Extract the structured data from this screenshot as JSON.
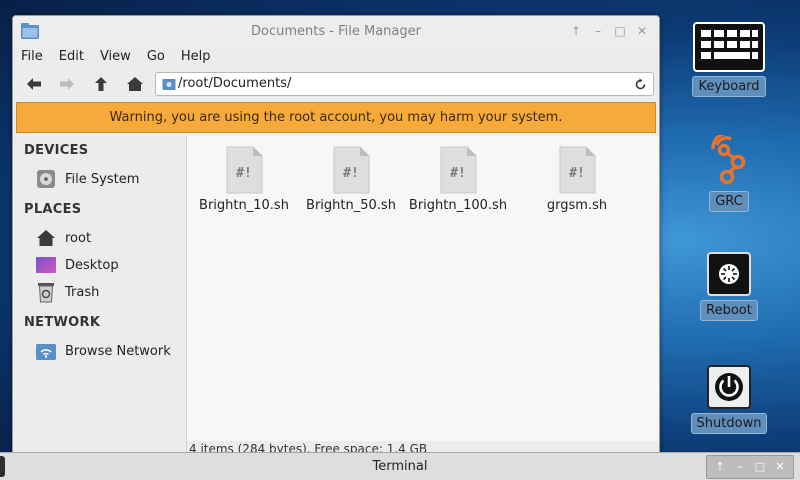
{
  "window": {
    "title": "Documents - File Manager",
    "buttons": [
      "↑",
      "–",
      "□",
      "✕"
    ]
  },
  "menu": [
    "File",
    "Edit",
    "View",
    "Go",
    "Help"
  ],
  "location": {
    "path": "/root/Documents/"
  },
  "warning": "Warning, you are using the root account, you may harm your system.",
  "sidebar": {
    "devices_heading": "DEVICES",
    "places_heading": "PLACES",
    "network_heading": "NETWORK",
    "devices": [
      {
        "label": "File System",
        "icon": "drive-icon"
      }
    ],
    "places": [
      {
        "label": "root",
        "icon": "home-icon"
      },
      {
        "label": "Desktop",
        "icon": "desktop-icon"
      },
      {
        "label": "Trash",
        "icon": "trash-icon"
      }
    ],
    "network": [
      {
        "label": "Browse Network",
        "icon": "network-icon"
      }
    ]
  },
  "files": [
    {
      "name": "Brightn_10.sh",
      "icon": "script-file-icon"
    },
    {
      "name": "Brightn_50.sh",
      "icon": "script-file-icon"
    },
    {
      "name": "Brightn_100.sh",
      "icon": "script-file-icon"
    },
    {
      "name": "grgsm.sh",
      "icon": "script-file-icon"
    }
  ],
  "status": "4 items (284 bytes), Free space: 1.4 GB",
  "desktop_icons": [
    {
      "label": "Keyboard",
      "icon": "keyboard-icon"
    },
    {
      "label": "GRC",
      "icon": "grc-icon"
    },
    {
      "label": "Reboot",
      "icon": "reboot-icon"
    },
    {
      "label": "Shutdown",
      "icon": "power-icon"
    }
  ],
  "taskbar": {
    "title": "Terminal",
    "buttons": [
      "↑",
      "–",
      "□",
      "✕"
    ]
  },
  "colors": {
    "warning_bg": "#f7a93a",
    "grc_orange": "#e8742a",
    "desktop_blue": "#1f6cb0"
  }
}
